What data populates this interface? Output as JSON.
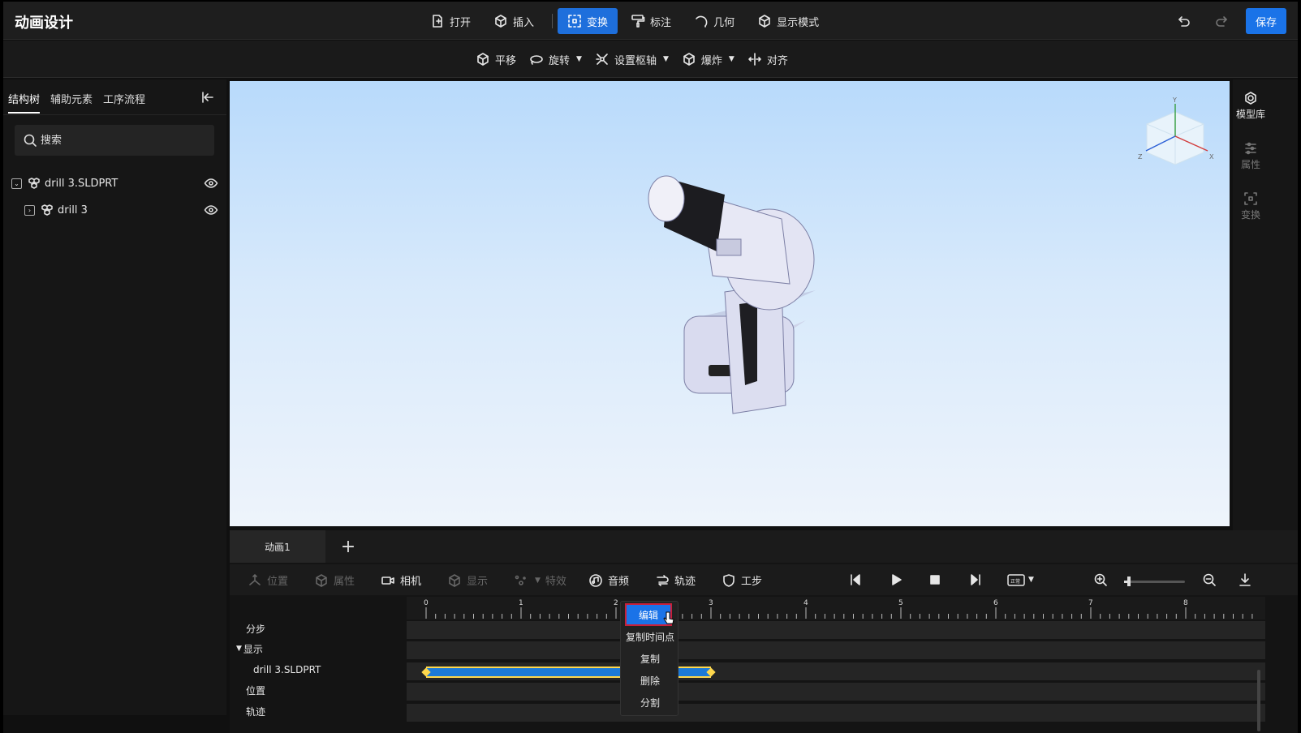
{
  "app": {
    "title": "动画设计"
  },
  "main_menu": [
    {
      "label": "打开",
      "icon": "open-file-icon"
    },
    {
      "label": "插入",
      "icon": "insert-cube-icon"
    },
    {
      "label": "变换",
      "icon": "transform-icon",
      "active": true
    },
    {
      "label": "标注",
      "icon": "annotate-brush-icon"
    },
    {
      "label": "几何",
      "icon": "geometry-arc-icon"
    },
    {
      "label": "显示模式",
      "icon": "display-mode-cube-icon"
    }
  ],
  "header_right": {
    "save_label": "保存",
    "undo_icon": "undo-icon",
    "redo_icon": "redo-icon"
  },
  "sub_toolbar": [
    {
      "label": "平移",
      "icon": "translate-cube-icon",
      "dropdown": false
    },
    {
      "label": "旋转",
      "icon": "rotate-icon",
      "dropdown": true
    },
    {
      "label": "设置枢轴",
      "icon": "pivot-icon",
      "dropdown": true
    },
    {
      "label": "爆炸",
      "icon": "explode-cube-icon",
      "dropdown": true
    },
    {
      "label": "对齐",
      "icon": "align-icon",
      "dropdown": false
    }
  ],
  "left_panel": {
    "tabs": [
      {
        "label": "结构树",
        "active": true
      },
      {
        "label": "辅助元素",
        "active": false
      },
      {
        "label": "工序流程",
        "active": false
      }
    ],
    "search": {
      "placeholder": "搜索"
    },
    "tree": [
      {
        "label": "drill 3.SLDPRT",
        "expanded": true,
        "level": 0
      },
      {
        "label": "drill 3",
        "expanded": false,
        "level": 1
      }
    ]
  },
  "right_rail": [
    {
      "label": "模型库",
      "icon": "model-library-icon",
      "enabled": true
    },
    {
      "label": "属性",
      "icon": "properties-sliders-icon",
      "enabled": false
    },
    {
      "label": "变换",
      "icon": "transform-icon",
      "enabled": false
    }
  ],
  "viewport": {
    "nav_cube_axes": [
      "Y",
      "X",
      "Z"
    ]
  },
  "timeline": {
    "tabs": [
      {
        "label": "动画1"
      }
    ],
    "add_tab": "+",
    "toolbar": [
      {
        "label": "位置",
        "icon": "position-axes-icon",
        "enabled": false
      },
      {
        "label": "属性",
        "icon": "properties-cube-icon",
        "enabled": false
      },
      {
        "label": "相机",
        "icon": "camera-icon",
        "enabled": true
      },
      {
        "label": "显示",
        "icon": "display-cube-icon",
        "enabled": false
      },
      {
        "label": "特效",
        "icon": "effects-icon",
        "enabled": false
      },
      {
        "label": "音频",
        "icon": "audio-icon",
        "enabled": true
      },
      {
        "label": "轨迹",
        "icon": "trajectory-icon",
        "enabled": true
      },
      {
        "label": "工步",
        "icon": "step-shield-icon",
        "enabled": true
      }
    ],
    "playback": [
      "step-back-icon",
      "play-icon",
      "stop-icon",
      "step-forward-icon",
      "speed-icon"
    ],
    "speed_label": "正常",
    "zoom_level": 0.08,
    "ruler_ticks": [
      "0",
      "1",
      "2",
      "3",
      "4",
      "5",
      "6",
      "7",
      "8"
    ],
    "tracks": [
      {
        "label": "分步",
        "indent": false
      },
      {
        "label": "显示",
        "indent": false,
        "group": true
      },
      {
        "label": "drill 3.SLDPRT",
        "indent": true
      },
      {
        "label": "位置",
        "indent": false
      },
      {
        "label": "轨迹",
        "indent": false
      }
    ],
    "clip": {
      "start": 0,
      "end": 3
    }
  },
  "context_menu": [
    "编辑",
    "复制时间点",
    "复制",
    "删除",
    "分割"
  ]
}
